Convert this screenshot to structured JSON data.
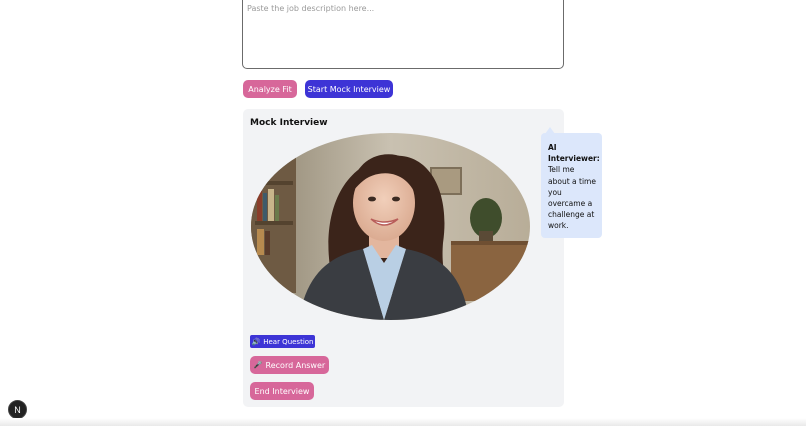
{
  "job_description": {
    "placeholder": "Paste the job description here..."
  },
  "actions": {
    "analyze_label": "Analyze Fit",
    "mock_label": "Start Mock Interview"
  },
  "mock_interview": {
    "title": "Mock Interview",
    "portrait_alt": "Interviewer portrait",
    "bubble": {
      "speaker": "AI Interviewer:",
      "question": "Tell me about a time you overcame a challenge at work."
    },
    "hear_icon": "🔊",
    "hear_label": "Hear Question",
    "record_icon": "🎤",
    "record_label": "Record Answer",
    "end_label": "End Interview"
  },
  "dev_badge": {
    "label": "N",
    "icon": "nextjs-logo-icon"
  },
  "colors": {
    "pink": "#d7679a",
    "indigo": "#3d34d6",
    "panel_bg": "#f2f3f5",
    "bubble_bg": "#dce7fb"
  }
}
